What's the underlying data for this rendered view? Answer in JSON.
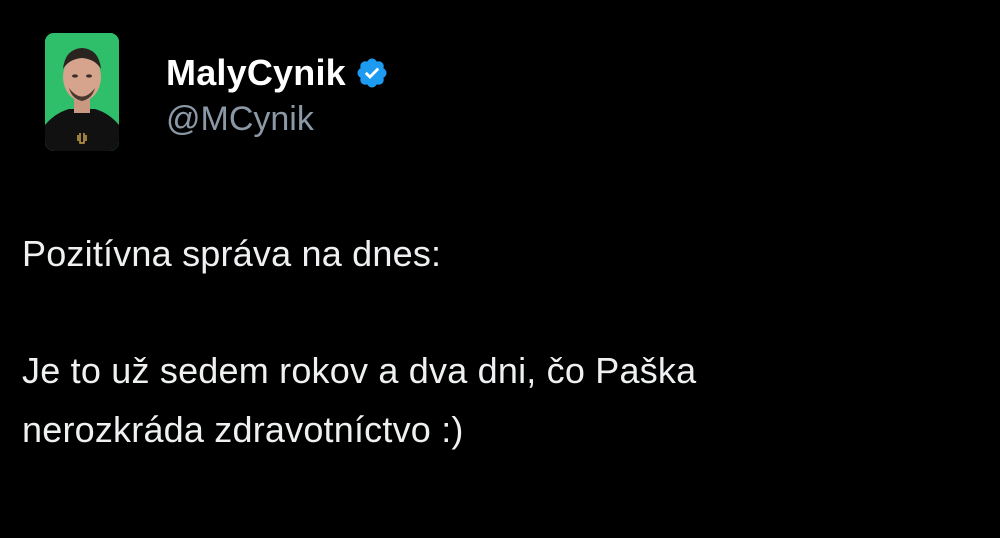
{
  "author": {
    "display_name": "MalyCynik",
    "handle": "@MCynik",
    "verified": true,
    "avatar_icon": "profile-photo",
    "verified_icon": "verified-badge-icon"
  },
  "tweet": {
    "line1": "Pozitívna správa na dnes:",
    "line2": "Je to už sedem rokov a dva dni, čo Paška",
    "line3": "nerozkráda zdravotníctvo :)"
  },
  "colors": {
    "background": "#000000",
    "text": "#e7e9ea",
    "handle": "#8b98a5",
    "verified": "#1d9bf0",
    "avatar_bg": "#2fbf6a"
  }
}
